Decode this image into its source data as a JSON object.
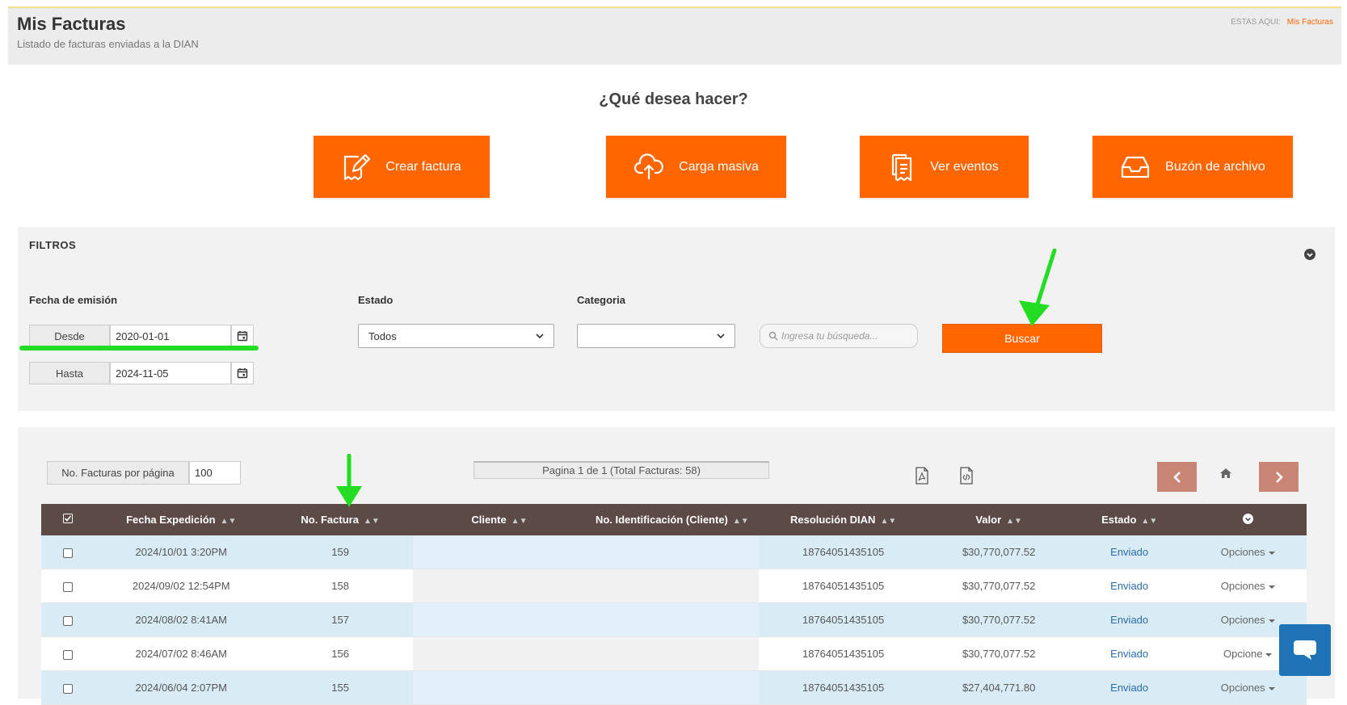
{
  "header": {
    "title": "Mis Facturas",
    "subtitle": "Listado de facturas enviadas a la DIAN",
    "breadcrumb_label": "ESTAS AQUI:",
    "breadcrumb_current": "Mis Facturas"
  },
  "question": "¿Qué desea hacer?",
  "actions": [
    {
      "label": "Crear factura",
      "icon": "invoice-edit-icon"
    },
    {
      "label": "Carga masiva",
      "icon": "cloud-upload-icon"
    },
    {
      "label": "Ver eventos",
      "icon": "documents-icon"
    },
    {
      "label": "Buzón de archivo",
      "icon": "inbox-icon"
    }
  ],
  "filters": {
    "title": "FILTROS",
    "fecha_label": "Fecha de emisión",
    "desde_label": "Desde",
    "desde_value": "2020-01-01",
    "hasta_label": "Hasta",
    "hasta_value": "2024-11-05",
    "estado_label": "Estado",
    "estado_value": "Todos",
    "categoria_label": "Categoria",
    "categoria_value": "",
    "search_placeholder": "Ingresa tu búsqueda...",
    "buscar_label": "Buscar"
  },
  "results": {
    "perpage_label": "No. Facturas por página",
    "perpage_value": "100",
    "page_info": "Pagina 1 de 1 (Total Facturas: 58)",
    "columns": [
      "Fecha Expedición",
      "No. Factura",
      "Cliente",
      "No. Identificación (Cliente)",
      "Resolución DIAN",
      "Valor",
      "Estado"
    ],
    "rows": [
      {
        "fecha": "2024/10/01 3:20PM",
        "numero": "159",
        "cliente": "",
        "identificacion": "",
        "resolucion": "18764051435105",
        "valor": "$30,770,077.52",
        "estado": "Enviado",
        "opciones": "Opciones"
      },
      {
        "fecha": "2024/09/02 12:54PM",
        "numero": "158",
        "cliente": "",
        "identificacion": "",
        "resolucion": "18764051435105",
        "valor": "$30,770,077.52",
        "estado": "Enviado",
        "opciones": "Opciones"
      },
      {
        "fecha": "2024/08/02 8:41AM",
        "numero": "157",
        "cliente": "",
        "identificacion": "",
        "resolucion": "18764051435105",
        "valor": "$30,770,077.52",
        "estado": "Enviado",
        "opciones": "Opciones"
      },
      {
        "fecha": "2024/07/02 8:46AM",
        "numero": "156",
        "cliente": "",
        "identificacion": "",
        "resolucion": "18764051435105",
        "valor": "$30,770,077.52",
        "estado": "Enviado",
        "opciones": "Opcione"
      },
      {
        "fecha": "2024/06/04 2:07PM",
        "numero": "155",
        "cliente": "",
        "identificacion": "",
        "resolucion": "18764051435105",
        "valor": "$27,404,771.80",
        "estado": "Enviado",
        "opciones": "Opciones"
      }
    ]
  },
  "colors": {
    "accent": "#ff6600",
    "table_header": "#5b4a45",
    "nav_button": "#c98676",
    "row_highlight": "#d9ecf6",
    "chat": "#1f73b7",
    "annotation": "#22dd22"
  }
}
